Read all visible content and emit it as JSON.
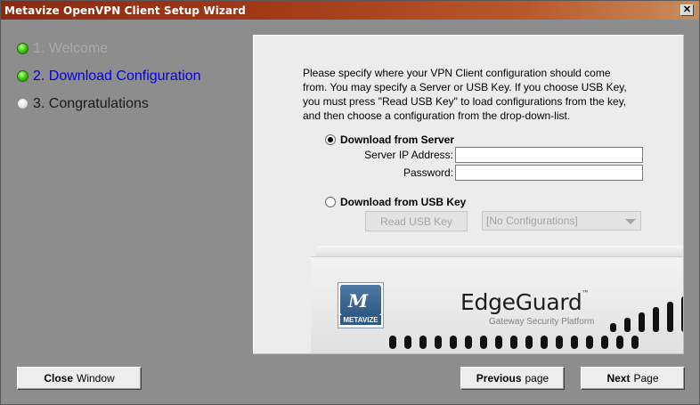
{
  "window": {
    "title": "Metavize OpenVPN Client Setup Wizard",
    "close_glyph": "✕"
  },
  "steps": [
    {
      "label": "1. Welcome",
      "state": "done",
      "indicator": "green"
    },
    {
      "label": "2. Download Configuration",
      "state": "current",
      "indicator": "green"
    },
    {
      "label": "3. Congratulations",
      "state": "pending",
      "indicator": "white"
    }
  ],
  "panel": {
    "description_lines": [
      "Please specify where your VPN Client configuration should come",
      "from. You may specify a Server or USB Key. If you choose USB Key,",
      "you must press \"Read USB Key\" to load configurations from the key,",
      "and then choose a configuration from the drop-down-list."
    ],
    "server_option": {
      "label": "Download from Server",
      "checked": true
    },
    "server_ip": {
      "label": "Server IP Address:",
      "value": ""
    },
    "password": {
      "label": "Password:",
      "value": ""
    },
    "usb_option": {
      "label": "Download from USB Key",
      "checked": false
    },
    "read_usb_button": "Read USB Key",
    "config_select": {
      "selected": "[No Configurations]"
    },
    "device": {
      "brand": "METAVIZE",
      "name": "EdgeGuard",
      "trademark": "™",
      "subtitle": "Gateway Security Platform"
    }
  },
  "buttons": {
    "close": {
      "bold": "Close",
      "rest": "Window"
    },
    "previous": {
      "bold": "Previous",
      "rest": "page"
    },
    "next": {
      "bold": "Next",
      "rest": "Page"
    }
  },
  "colors": {
    "title_gradient_start": "#8b2a12",
    "current_step": "#0000e6",
    "done_step": "#a9a9a9",
    "window_bg": "#8d8d8d"
  }
}
